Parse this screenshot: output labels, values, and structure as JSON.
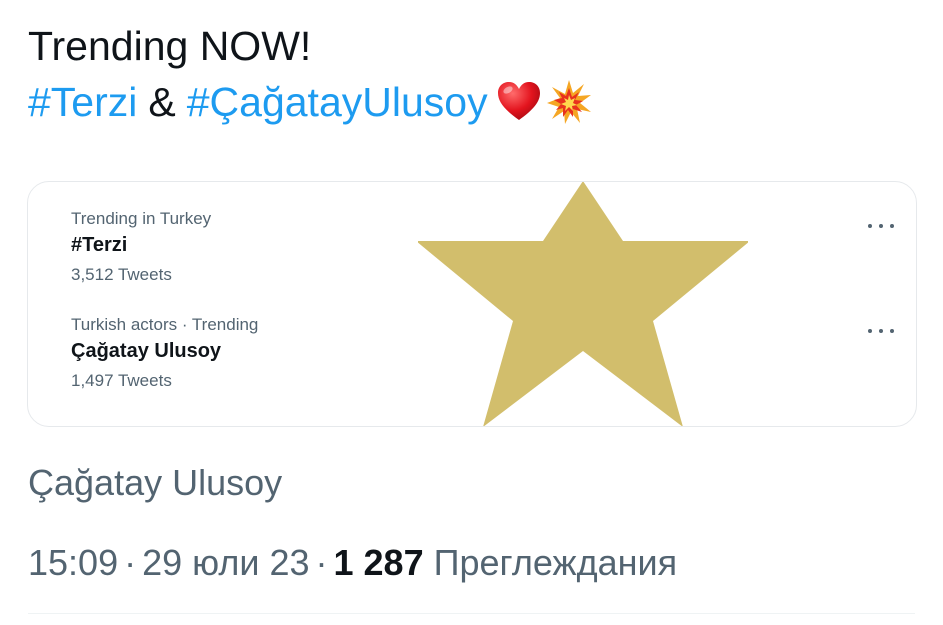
{
  "tweet": {
    "line1": "Trending NOW!",
    "hashtag1": "#Terzi",
    "ampersand": "&",
    "hashtag2": "#ÇağatayUlusoy",
    "emojis": [
      "red-heart-icon",
      "collision-icon"
    ]
  },
  "trends_card": {
    "items": [
      {
        "context": "Trending in Turkey",
        "name": "#Terzi",
        "count": "3,512 Tweets"
      },
      {
        "context": "Turkish actors · Trending",
        "name": "Çağatay Ulusoy",
        "count": "1,497 Tweets"
      }
    ],
    "more_icon": "more-horizontal-icon",
    "overlay_icon": "star-icon",
    "overlay_color": "#d2be6c"
  },
  "author_text": "Çağatay Ulusoy",
  "meta": {
    "time": "15:09",
    "date": "29 юли 23",
    "views_count": "1 287",
    "views_label": "Преглеждания",
    "separator": "·"
  },
  "colors": {
    "hashtag": "#1d9bf0",
    "text_primary": "#0f1419",
    "text_secondary": "#536471"
  }
}
